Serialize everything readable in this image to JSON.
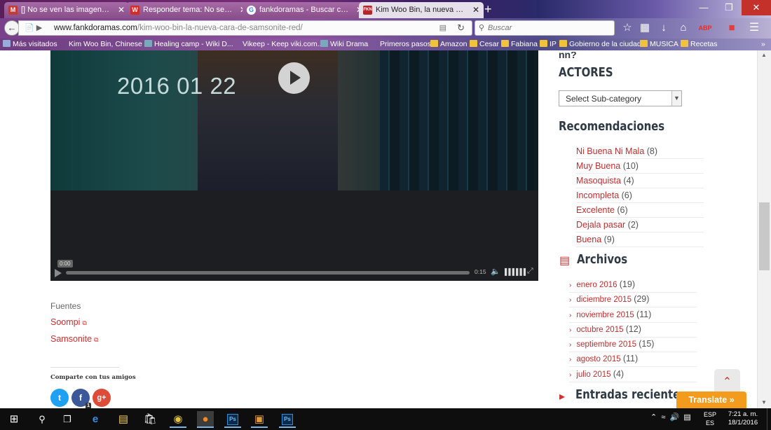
{
  "browser": {
    "tabs": [
      {
        "label": "[] No se ven las imagenes ...",
        "fav_color": "#c23a3a",
        "fav_text": "M"
      },
      {
        "label": "Responder tema: No se v...",
        "fav_color": "#d42a2a",
        "fav_text": "W"
      },
      {
        "label": "fankdoramas - Buscar con...",
        "fav_color": "#ffffff",
        "fav_text": "G"
      },
      {
        "label": "Kim Woo Bin, la nueva car...",
        "fav_color": "#b5252a",
        "fav_text": "FKN"
      }
    ],
    "new_tab": "+",
    "url_domain": "www.fankdoramas.com",
    "url_path": "/kim-woo-bin-la-nueva-cara-de-samsonite-red/",
    "search_placeholder": "Buscar",
    "bookmarks": [
      "Más visitados",
      "Kim Woo Bin, Chinese ...",
      "Healing camp - Wiki D...",
      "Vikeep - Keep viki.com...",
      "Wiki Drama",
      "Primeros pasos",
      "Amazon",
      "Cesar",
      "Fabiana",
      "IP",
      "Gobierno de la ciudad",
      "MUSICA",
      "Recetas"
    ]
  },
  "video": {
    "overlay_text": "2016 01 22",
    "current_time": "0:00",
    "duration": "0:15"
  },
  "post": {
    "sources_label": "Fuentes",
    "sources": [
      "Soompi",
      "Samsonite"
    ],
    "share_title": "Comparte con tus amigos",
    "facebook_count": "1"
  },
  "sidebar": {
    "partial_heading": "nn?",
    "actores_heading": "ACTORES",
    "select_value": "Select Sub-category",
    "recomendaciones_heading": "Recomendaciones",
    "recomendaciones": [
      {
        "label": "Ni Buena Ni Mala",
        "count": "(8)"
      },
      {
        "label": "Muy Buena",
        "count": "(10)"
      },
      {
        "label": "Masoquista",
        "count": "(4)"
      },
      {
        "label": "Incompleta",
        "count": "(6)"
      },
      {
        "label": "Excelente",
        "count": "(6)"
      },
      {
        "label": "Dejala pasar",
        "count": "(2)"
      },
      {
        "label": "Buena",
        "count": "(9)"
      }
    ],
    "archivos_heading": "Archivos",
    "archivos": [
      {
        "label": "enero 2016",
        "count": "(19)"
      },
      {
        "label": "diciembre 2015",
        "count": "(29)"
      },
      {
        "label": "noviembre 2015",
        "count": "(11)"
      },
      {
        "label": "octubre 2015",
        "count": "(12)"
      },
      {
        "label": "septiembre 2015",
        "count": "(15)"
      },
      {
        "label": "agosto 2015",
        "count": "(11)"
      },
      {
        "label": "julio 2015",
        "count": "(4)"
      }
    ],
    "entradas_heading": "Entradas recientes"
  },
  "translate_label": "Translate »",
  "taskbar": {
    "lang_top": "ESP",
    "lang_bottom": "ES",
    "time": "7:21 a. m.",
    "date": "18/1/2016"
  },
  "colors": {
    "link_red": "#c22d2d",
    "heading_dark": "#2f3a45",
    "translate_orange": "#f39b1c"
  }
}
